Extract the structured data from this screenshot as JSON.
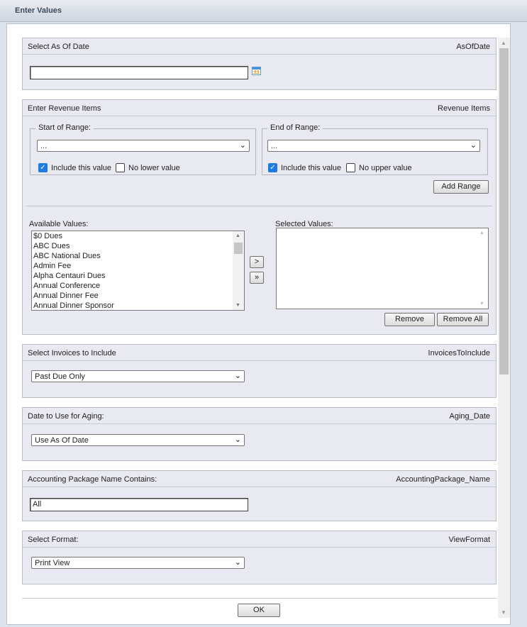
{
  "window": {
    "title": "Enter Values"
  },
  "as_of_date": {
    "label": "Select As Of Date",
    "param": "AsOfDate",
    "value": "",
    "icon": "calendar-icon"
  },
  "revenue_items": {
    "label": "Enter Revenue Items",
    "param": "Revenue Items",
    "start_range": {
      "legend": "Start of Range:",
      "selected": "...",
      "include_label": "Include this value",
      "include_checked": true,
      "no_bound_label": "No lower value",
      "no_bound_checked": false
    },
    "end_range": {
      "legend": "End of Range:",
      "selected": "...",
      "include_label": "Include this value",
      "include_checked": true,
      "no_bound_label": "No upper value",
      "no_bound_checked": false
    },
    "add_range_label": "Add Range",
    "available_label": "Available Values:",
    "available_values": [
      "$0 Dues",
      "ABC Dues",
      "ABC National Dues",
      "Admin Fee",
      "Alpha Centauri Dues",
      "Annual Conference",
      "Annual Dinner Fee",
      "Annual Dinner Sponsor"
    ],
    "move_one_label": ">",
    "move_all_label": "»",
    "selected_label": "Selected Values:",
    "selected_values": [],
    "remove_label": "Remove",
    "remove_all_label": "Remove All"
  },
  "invoices": {
    "label": "Select Invoices to Include",
    "param": "InvoicesToInclude",
    "selected": "Past Due Only"
  },
  "aging": {
    "label": "Date to Use for Aging:",
    "param": "Aging_Date",
    "selected": "Use As Of Date"
  },
  "accounting": {
    "label": "Accounting Package Name Contains:",
    "param": "AccountingPackage_Name",
    "value": "All"
  },
  "format": {
    "label": "Select Format:",
    "param": "ViewFormat",
    "selected": "Print View"
  },
  "ok_label": "OK"
}
